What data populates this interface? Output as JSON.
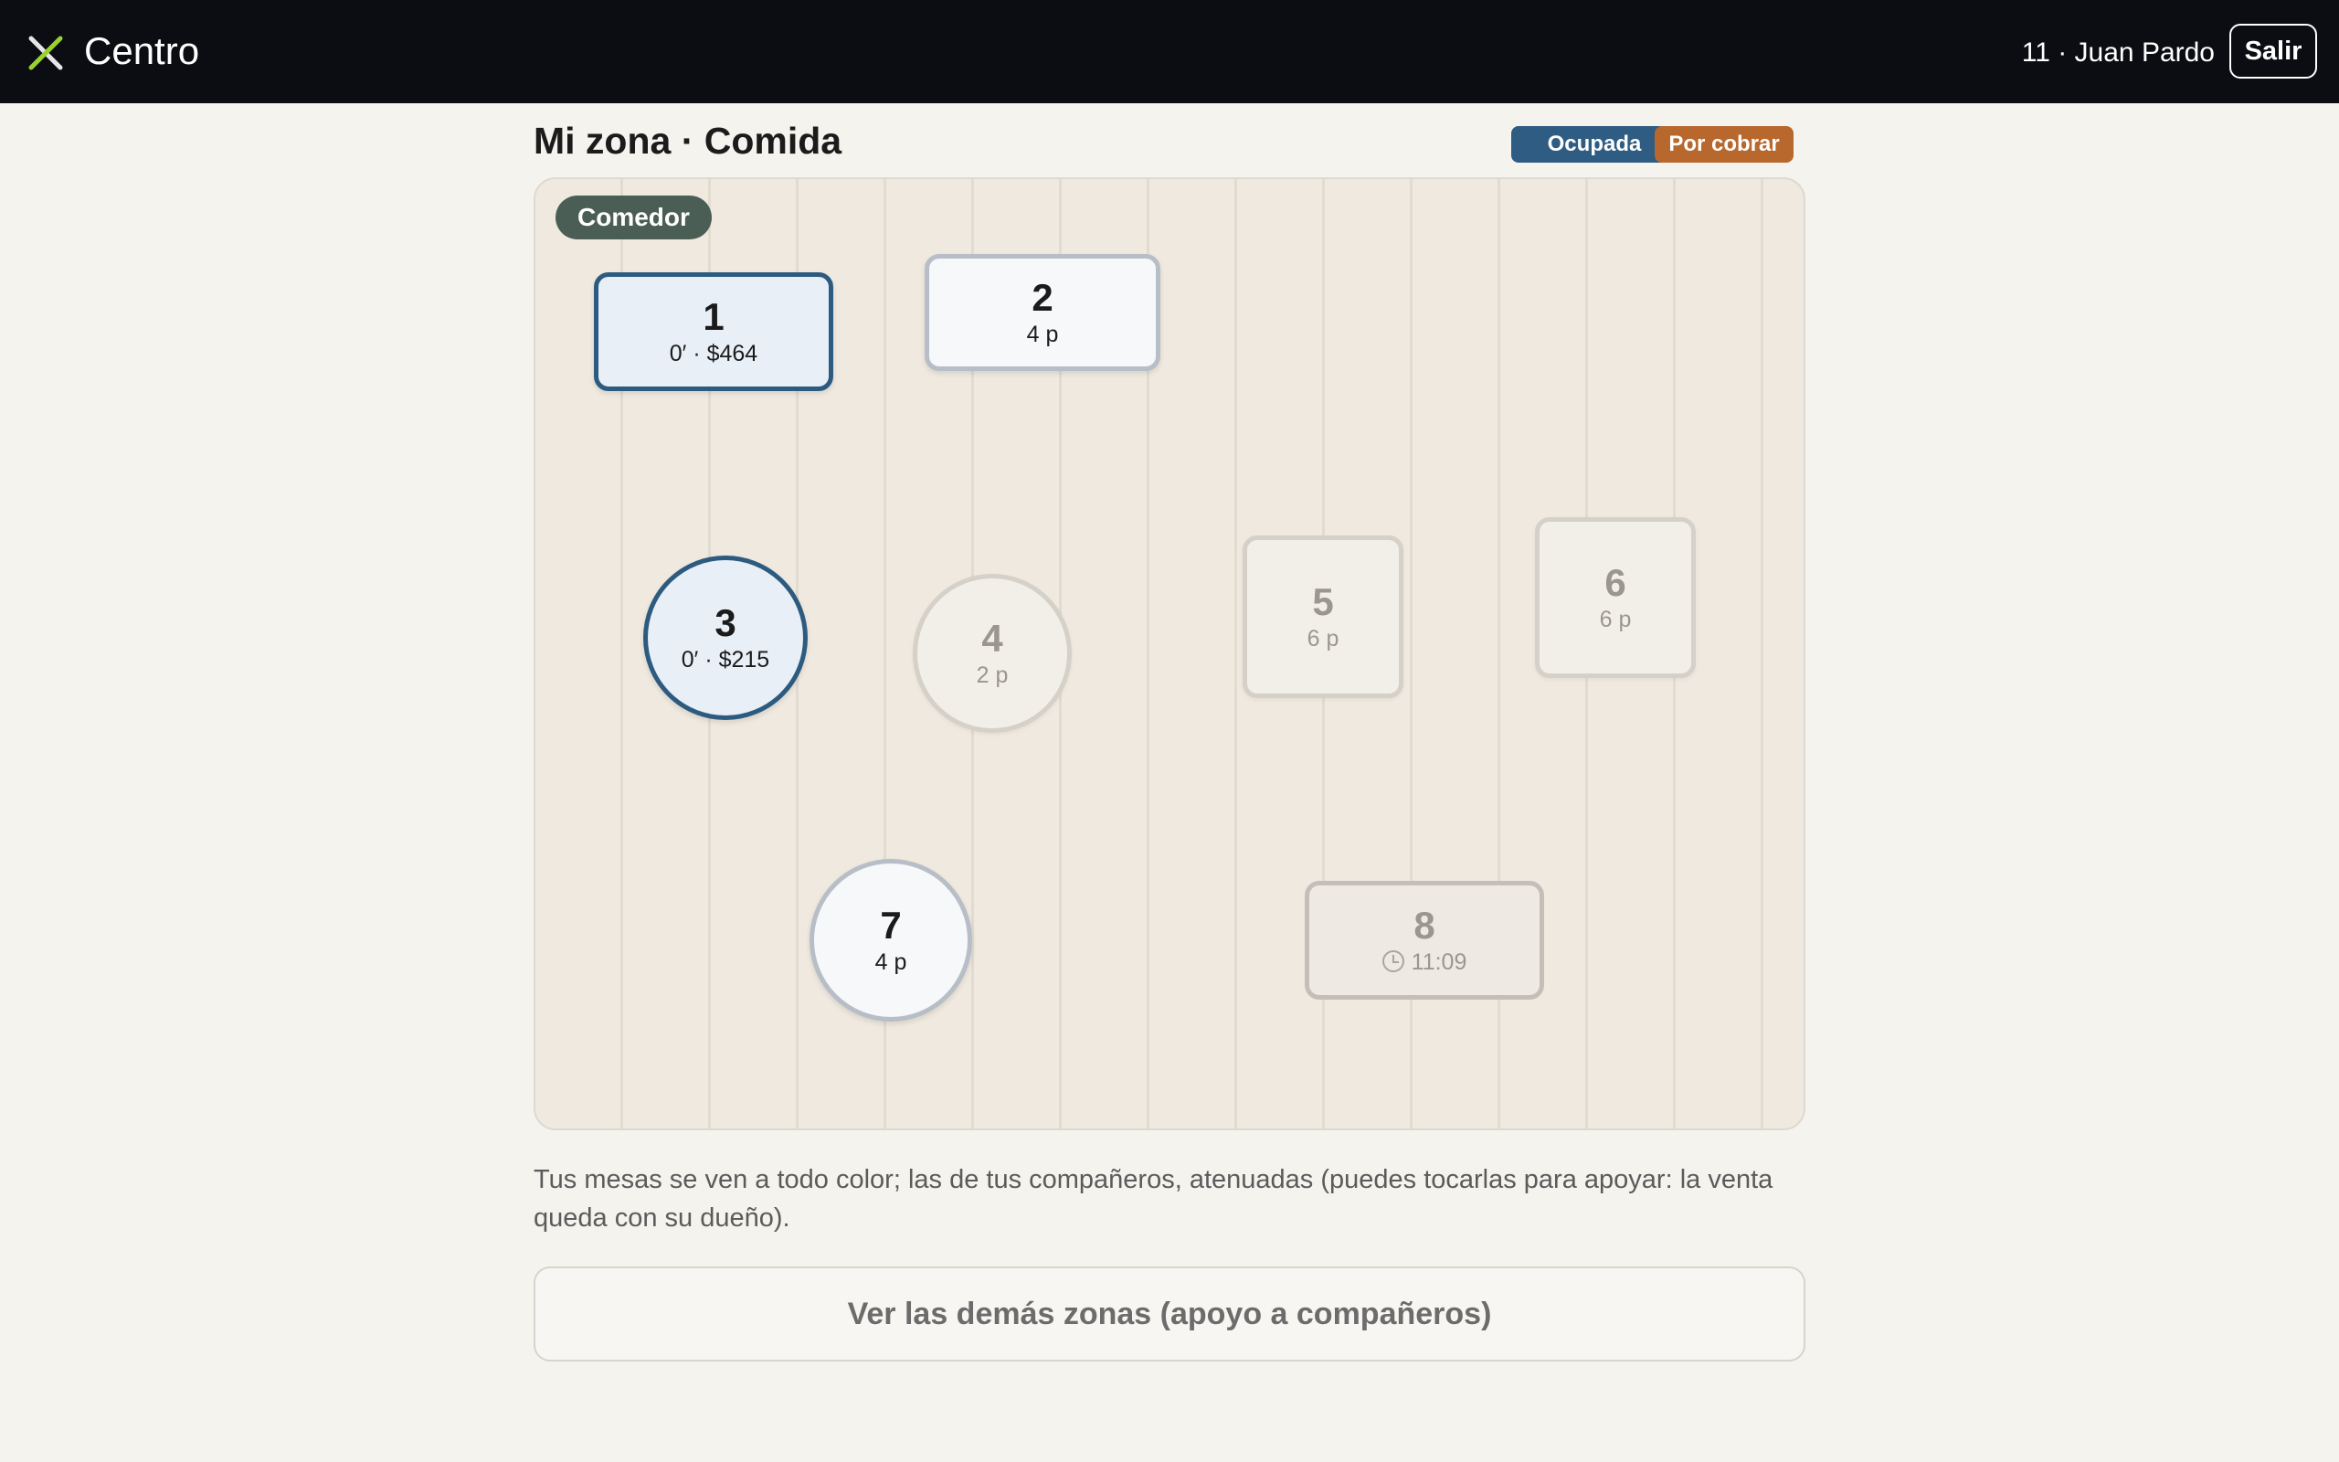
{
  "app": {
    "brand": "Centro",
    "user_label": "11 · Juan Pardo",
    "logout_label": "Salir"
  },
  "page": {
    "title": "Mi zona · Comida",
    "legend": [
      {
        "label": "Ocupada",
        "color": "#2e5c82"
      },
      {
        "label": "Por cobrar",
        "color": "#b8672d"
      }
    ]
  },
  "floor": {
    "zone_label": "Comedor",
    "tables": [
      {
        "number": "1",
        "detail": "0′ · $464",
        "shape": "rect",
        "state": "mine-occupied"
      },
      {
        "number": "2",
        "detail": "4 p",
        "shape": "rect",
        "state": "mine-free"
      },
      {
        "number": "3",
        "detail": "0′ · $215",
        "shape": "round",
        "state": "mine-occupied"
      },
      {
        "number": "4",
        "detail": "2 p",
        "shape": "round",
        "state": "colleague"
      },
      {
        "number": "5",
        "detail": "6 p",
        "shape": "rect",
        "state": "colleague"
      },
      {
        "number": "6",
        "detail": "6 p",
        "shape": "rect",
        "state": "colleague"
      },
      {
        "number": "7",
        "detail": "4 p",
        "shape": "round",
        "state": "mine-free"
      },
      {
        "number": "8",
        "detail": "11:09",
        "shape": "rect",
        "state": "colleague-reserved",
        "icon": "clock-icon"
      }
    ]
  },
  "help_text": "Tus mesas se ven a todo color; las de tus compañeros, atenuadas (puedes tocarlas para apoyar: la venta queda con su dueño).",
  "other_zones_label": "Ver las demás zonas (apoyo a compañeros)",
  "colors": {
    "topbar": "#0b0d12",
    "mine_border": "#2d5b80",
    "zone_label_bg": "#4b5e55",
    "logo_accent": "#9bd12f"
  }
}
